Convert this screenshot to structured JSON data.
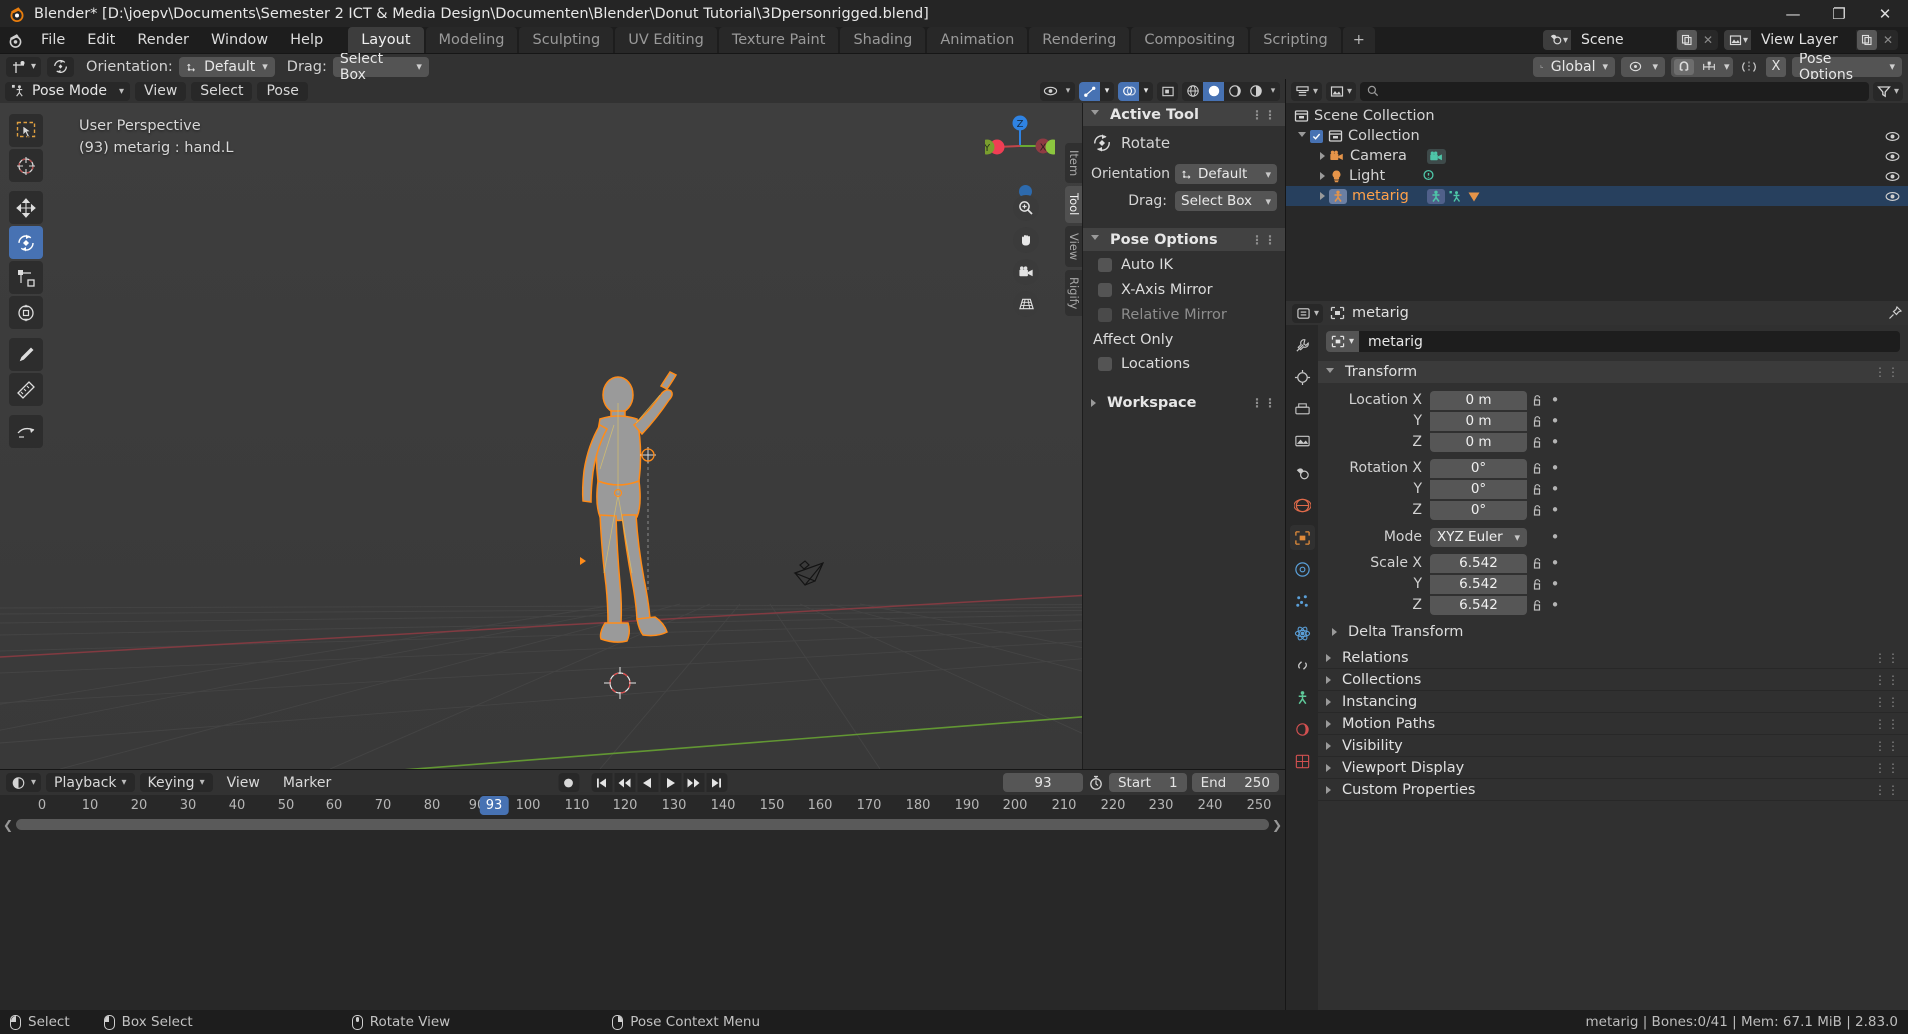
{
  "window": {
    "title": "Blender* [D:\\joepv\\Documents\\Semester 2 ICT & Media Design\\Documenten\\Blender\\Donut Tutorial\\3Dpersonrigged.blend]",
    "minimize": "—",
    "maximize": "❐",
    "close": "✕"
  },
  "topbar": {
    "menus": [
      "File",
      "Edit",
      "Render",
      "Window",
      "Help"
    ],
    "workspaces": [
      {
        "label": "Layout",
        "active": true
      },
      {
        "label": "Modeling",
        "active": false
      },
      {
        "label": "Sculpting",
        "active": false
      },
      {
        "label": "UV Editing",
        "active": false
      },
      {
        "label": "Texture Paint",
        "active": false
      },
      {
        "label": "Shading",
        "active": false
      },
      {
        "label": "Animation",
        "active": false
      },
      {
        "label": "Rendering",
        "active": false
      },
      {
        "label": "Compositing",
        "active": false
      },
      {
        "label": "Scripting",
        "active": false
      }
    ],
    "add_workspace": "+",
    "scene_name": "Scene",
    "view_layer_name": "View Layer"
  },
  "tool_settings": {
    "orientation_label": "Orientation:",
    "orientation_value": "Default",
    "drag_label": "Drag:",
    "drag_value": "Select Box",
    "transform_orientation": "Global",
    "pose_options": "Pose Options",
    "mirror_x": "X"
  },
  "viewport": {
    "mode": "Pose Mode",
    "menus": [
      "View",
      "Select",
      "Pose"
    ],
    "overlay_line1": "User Perspective",
    "overlay_line2": "(93) metarig : hand.L",
    "gizmo_axes": {
      "x": "X",
      "y": "Y",
      "z": "Z"
    }
  },
  "npanel": {
    "tabs": [
      {
        "label": "Item",
        "active": false
      },
      {
        "label": "Tool",
        "active": true
      },
      {
        "label": "View",
        "active": false
      },
      {
        "label": "Rigify",
        "active": false
      }
    ],
    "active_tool": {
      "title": "Active Tool",
      "tool_name": "Rotate",
      "orientation_label": "Orientation",
      "orientation_value": "Default",
      "drag_label": "Drag:",
      "drag_value": "Select Box"
    },
    "pose_options": {
      "title": "Pose Options",
      "auto_ik": "Auto IK",
      "x_axis_mirror": "X-Axis Mirror",
      "relative_mirror": "Relative Mirror",
      "affect_only": "Affect Only",
      "locations": "Locations"
    },
    "workspace": "Workspace"
  },
  "outliner": {
    "search_placeholder": "",
    "rows": [
      {
        "name": "Scene Collection",
        "indent": 0,
        "type": "scene",
        "selected": false,
        "eye": false,
        "checkbox": false,
        "arrow": "none"
      },
      {
        "name": "Collection",
        "indent": 1,
        "type": "collection",
        "selected": false,
        "eye": true,
        "checkbox": true,
        "arrow": "down"
      },
      {
        "name": "Camera",
        "indent": 2,
        "type": "camera",
        "selected": false,
        "eye": true,
        "checkbox": false,
        "arrow": "right"
      },
      {
        "name": "Light",
        "indent": 2,
        "type": "light",
        "selected": false,
        "eye": true,
        "checkbox": false,
        "arrow": "right"
      },
      {
        "name": "metarig",
        "indent": 2,
        "type": "armature",
        "selected": true,
        "eye": true,
        "checkbox": false,
        "arrow": "right"
      }
    ]
  },
  "properties": {
    "breadcrumb_object": "metarig",
    "object_name": "metarig",
    "transform": {
      "title": "Transform",
      "location_label": "Location X",
      "location": [
        "0 m",
        "0 m",
        "0 m"
      ],
      "rotation_label": "Rotation X",
      "rotation": [
        "0°",
        "0°",
        "0°"
      ],
      "axis_y": "Y",
      "axis_z": "Z",
      "mode_label": "Mode",
      "mode_value": "XYZ Euler",
      "scale_label": "Scale X",
      "scale": [
        "6.542",
        "6.542",
        "6.542"
      ],
      "delta_transform": "Delta Transform"
    },
    "panels": [
      "Relations",
      "Collections",
      "Instancing",
      "Motion Paths",
      "Visibility",
      "Viewport Display",
      "Custom Properties"
    ]
  },
  "timeline": {
    "menus": [
      "Playback",
      "Keying",
      "View",
      "Marker"
    ],
    "current_frame": "93",
    "start_label": "Start",
    "start_value": "1",
    "end_label": "End",
    "end_value": "250",
    "ticks": [
      "0",
      "10",
      "20",
      "30",
      "40",
      "50",
      "60",
      "70",
      "80",
      "90",
      "100",
      "110",
      "120",
      "130",
      "140",
      "150",
      "160",
      "170",
      "180",
      "190",
      "200",
      "210",
      "220",
      "230",
      "240",
      "250"
    ],
    "playhead_label": "93"
  },
  "status": {
    "items": [
      {
        "label": "Select",
        "mouse": "left"
      },
      {
        "label": "Box Select",
        "mouse": "left-drag"
      },
      {
        "label": "Rotate View",
        "mouse": "middle"
      },
      {
        "label": "Pose Context Menu",
        "mouse": "right"
      }
    ],
    "right": "metarig | Bones:0/41 | Mem: 67.1 MiB | 2.83.0"
  },
  "colors": {
    "accent_blue": "#4772b3",
    "orange": "#ed9e5c",
    "select_orange": "#ff8c1a",
    "axis_x": "#c1464a",
    "axis_y": "#7cb342",
    "axis_z": "#2f83e3"
  }
}
